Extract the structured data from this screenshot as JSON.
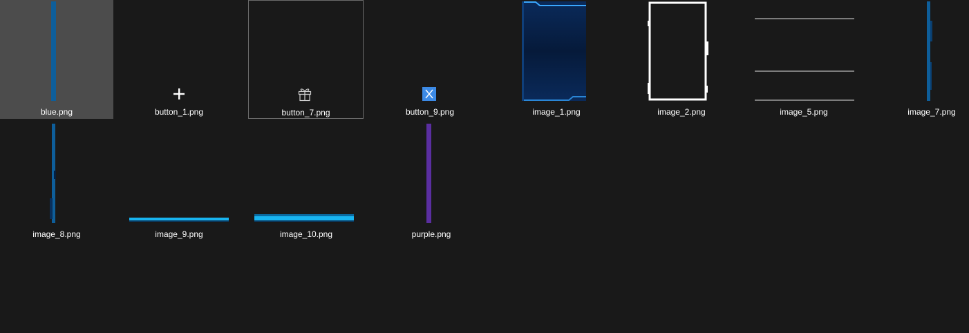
{
  "files": [
    {
      "name": "blue.png",
      "icon": "blue-bar-thumbnail",
      "selected": true
    },
    {
      "name": "button_1.png",
      "icon": "plus-icon"
    },
    {
      "name": "button_7.png",
      "icon": "gift-icon",
      "focused": true
    },
    {
      "name": "button_9.png",
      "icon": "x-square-icon"
    },
    {
      "name": "image_1.png",
      "icon": "blue-panel-thumbnail"
    },
    {
      "name": "image_2.png",
      "icon": "white-frame-thumbnail"
    },
    {
      "name": "image_5.png",
      "icon": "lines-thumbnail"
    },
    {
      "name": "image_7.png",
      "icon": "blue-edge-thumbnail"
    },
    {
      "name": "image_8.png",
      "icon": "blue-edge-thumbnail"
    },
    {
      "name": "image_9.png",
      "icon": "cyan-bar-thumbnail"
    },
    {
      "name": "image_10.png",
      "icon": "cyan-bar-thumbnail"
    },
    {
      "name": "purple.png",
      "icon": "purple-bar-thumbnail"
    }
  ],
  "colors": {
    "background": "#191919",
    "selected": "#4c4c4c",
    "blue": "#0e5e9a",
    "cyan": "#18b4f0",
    "purple": "#5a2ea0",
    "accent": "#3c8ae6"
  }
}
